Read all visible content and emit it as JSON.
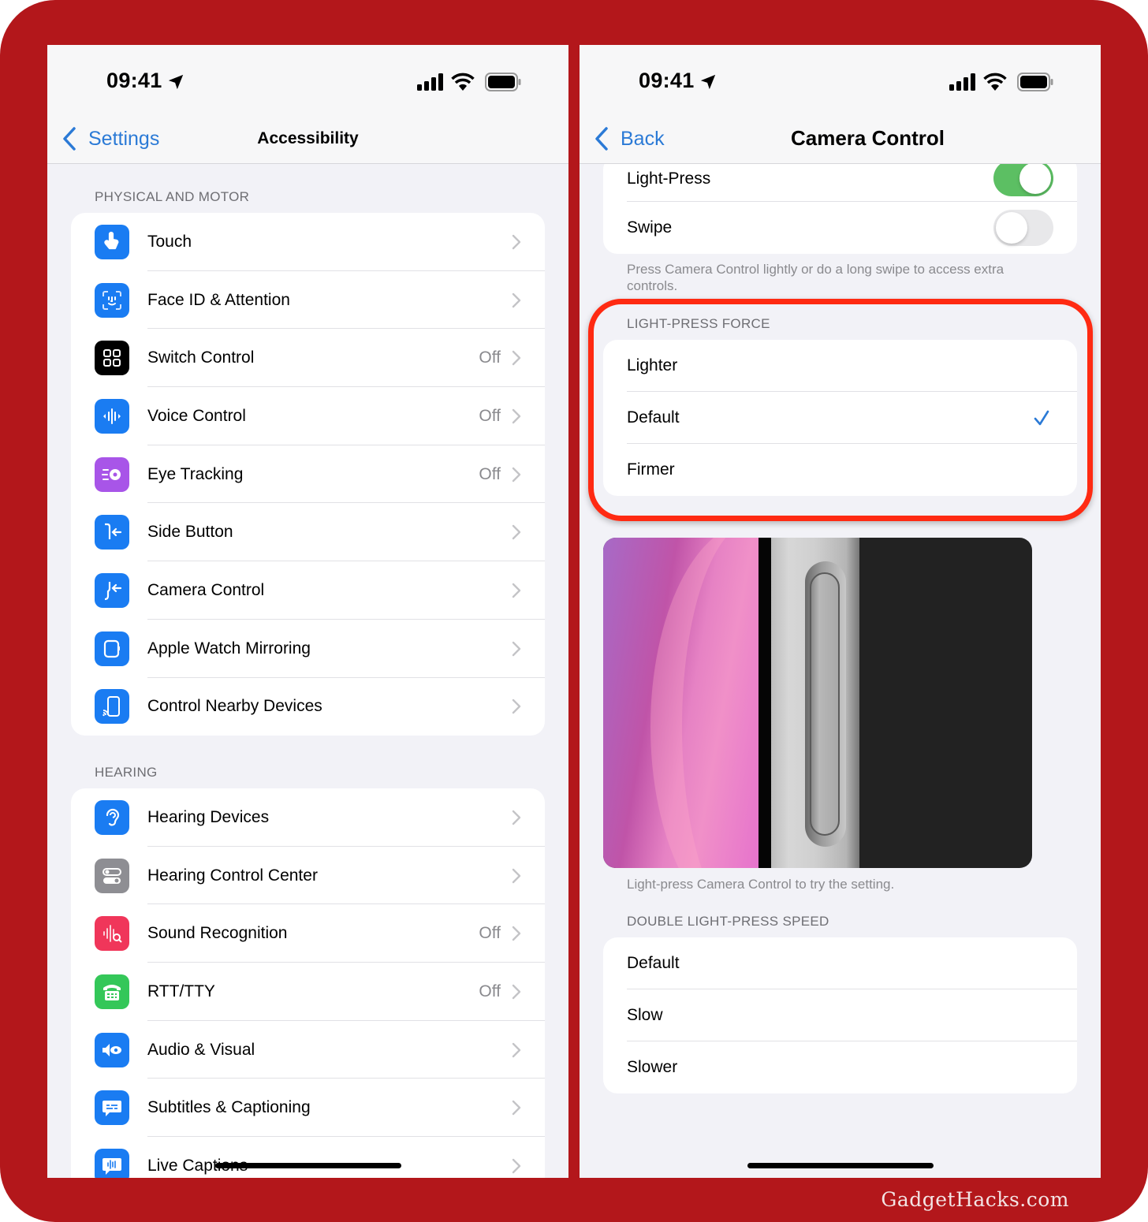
{
  "left": {
    "status": {
      "time": "09:41"
    },
    "nav": {
      "back_label": "Settings",
      "title": "Accessibility"
    },
    "sections": [
      {
        "header": "PHYSICAL AND MOTOR",
        "items": [
          {
            "label": "Touch",
            "value": "",
            "icon": "touch-hand-icon",
            "color": "#1a7cf2"
          },
          {
            "label": "Face ID & Attention",
            "value": "",
            "icon": "face-id-icon",
            "color": "#1a7cf2"
          },
          {
            "label": "Switch Control",
            "value": "Off",
            "icon": "switch-control-grid-icon",
            "color": "#000000"
          },
          {
            "label": "Voice Control",
            "value": "Off",
            "icon": "voice-waveform-icon",
            "color": "#1a7cf2"
          },
          {
            "label": "Eye Tracking",
            "value": "Off",
            "icon": "eye-tracking-icon",
            "color": "#a855e8"
          },
          {
            "label": "Side Button",
            "value": "",
            "icon": "side-button-icon",
            "color": "#1a7cf2"
          },
          {
            "label": "Camera Control",
            "value": "",
            "icon": "camera-control-icon",
            "color": "#1a7cf2"
          },
          {
            "label": "Apple Watch Mirroring",
            "value": "",
            "icon": "apple-watch-icon",
            "color": "#1a7cf2"
          },
          {
            "label": "Control Nearby Devices",
            "value": "",
            "icon": "nearby-devices-icon",
            "color": "#1a7cf2"
          }
        ]
      },
      {
        "header": "HEARING",
        "items": [
          {
            "label": "Hearing Devices",
            "value": "",
            "icon": "ear-icon",
            "color": "#1a7cf2"
          },
          {
            "label": "Hearing Control Center",
            "value": "",
            "icon": "toggles-icon",
            "color": "#8e8e93"
          },
          {
            "label": "Sound Recognition",
            "value": "Off",
            "icon": "sound-recognition-icon",
            "color": "#f0365a"
          },
          {
            "label": "RTT/TTY",
            "value": "Off",
            "icon": "tty-phone-icon",
            "color": "#34c759"
          },
          {
            "label": "Audio & Visual",
            "value": "",
            "icon": "speaker-eye-icon",
            "color": "#1a7cf2"
          },
          {
            "label": "Subtitles & Captioning",
            "value": "",
            "icon": "subtitles-bubble-icon",
            "color": "#1a7cf2"
          },
          {
            "label": "Live Captions",
            "value": "",
            "icon": "live-captions-icon",
            "color": "#1a7cf2"
          }
        ]
      }
    ]
  },
  "right": {
    "status": {
      "time": "09:41"
    },
    "nav": {
      "back_label": "Back",
      "title": "Camera Control"
    },
    "toggles": [
      {
        "label": "Light-Press",
        "on": true
      },
      {
        "label": "Swipe",
        "on": false
      }
    ],
    "toggles_footnote": "Press Camera Control lightly or do a long swipe to access extra controls.",
    "force": {
      "header": "LIGHT-PRESS FORCE",
      "options": [
        "Lighter",
        "Default",
        "Firmer"
      ],
      "selected": "Default"
    },
    "preview_caption": "Light-press Camera Control to try the setting.",
    "speed": {
      "header": "DOUBLE LIGHT-PRESS SPEED",
      "options": [
        "Default",
        "Slow",
        "Slower"
      ]
    }
  },
  "watermark": "GadgetHacks.com",
  "colors": {
    "accent": "#2b7ad6",
    "toggle_on": "#5cbf63",
    "highlight": "#ff2a12",
    "frame": "#b3171b"
  }
}
